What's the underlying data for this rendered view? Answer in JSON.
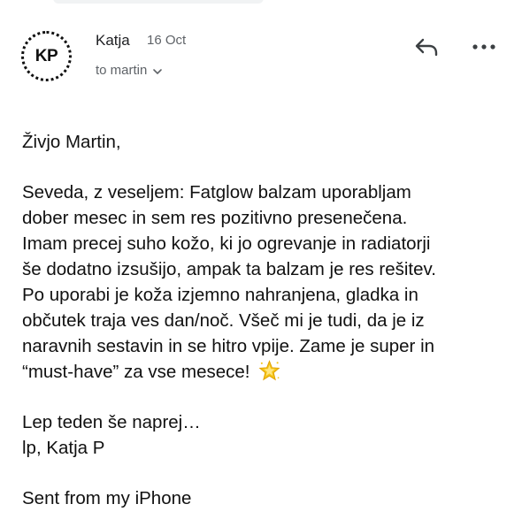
{
  "header": {
    "avatar_initials": "KP",
    "sender": "Katja",
    "date": "16 Oct",
    "recipient": "to martin"
  },
  "icons": {
    "reply": "reply-arrow-icon",
    "more": "more-horizontal-icon",
    "chevron": "chevron-down-icon",
    "emoji": "glowing-star-emoji"
  },
  "message": {
    "greeting": "Živjo Martin,",
    "lines": [
      "Seveda, z veseljem: Fatglow balzam uporabljam",
      "dober mesec in sem res pozitivno presenečena.",
      "Imam precej suho kožo, ki jo ogrevanje in radiatorji",
      "še dodatno izsušijo, ampak ta balzam je res rešitev.",
      "Po uporabi je koža izjemno nahranjena, gladka in",
      "občutek traja ves dan/noč. Všeč mi je tudi, da je iz",
      "naravnih sestavin in se hitro vpije. Zame je super in",
      "“must-have” za vse mesece!"
    ],
    "closing_1": "Lep teden še naprej…",
    "closing_2": "lp, Katja P",
    "signature": "Sent from my iPhone"
  }
}
